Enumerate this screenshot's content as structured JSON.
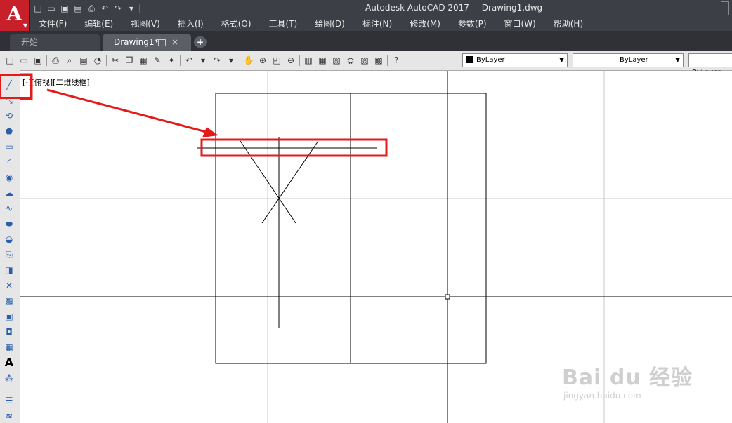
{
  "window": {
    "app_title": "Autodesk AutoCAD 2017",
    "file_title": "Drawing1.dwg",
    "app_logo": "A"
  },
  "menu": {
    "items": [
      "文件(F)",
      "编辑(E)",
      "视图(V)",
      "插入(I)",
      "格式(O)",
      "工具(T)",
      "绘图(D)",
      "标注(N)",
      "修改(M)",
      "参数(P)",
      "窗口(W)",
      "帮助(H)"
    ]
  },
  "tabs": {
    "start_label": "开始",
    "drawing_label": "Drawing1*",
    "add_label": "+",
    "close_label": "×"
  },
  "properties": {
    "color_value": "ByLayer",
    "linetype_value": "ByLayer",
    "lineweight_value": "ByLayer"
  },
  "viewport": {
    "label": "[-][俯视][二维线框]"
  },
  "watermark": {
    "brand": "Bai du 经验",
    "url": "jingyan.baidu.com"
  },
  "annotation": {
    "highlight_color": "#e31b1b"
  }
}
